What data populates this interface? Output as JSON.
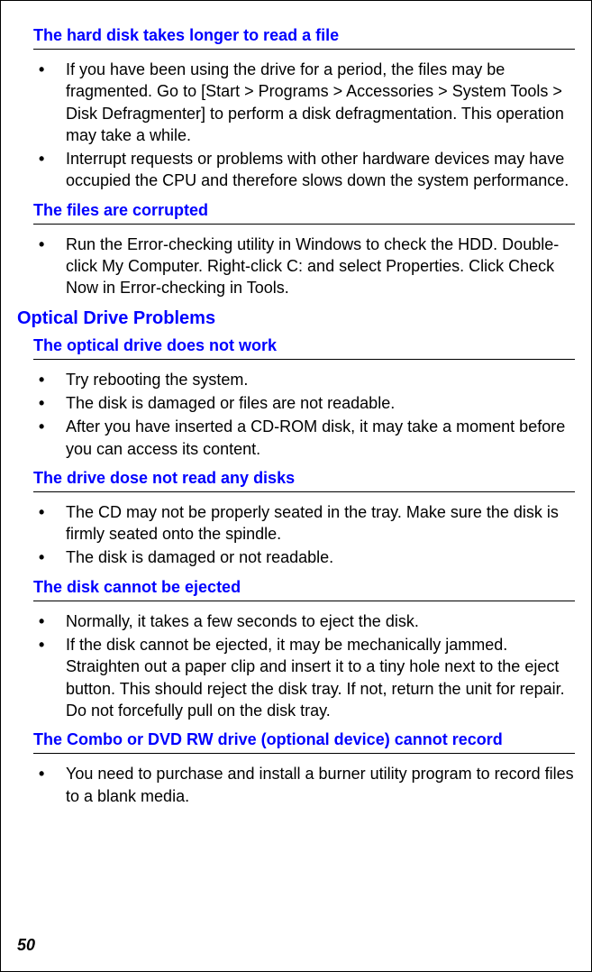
{
  "section1": {
    "heading1": "The hard disk takes longer to read a file",
    "bullets1": [
      "If you have been using the drive for a period, the files may be fragmented. Go to [Start > Programs > Accessories > System Tools > Disk Defragmenter] to perform a disk defragmentation. This operation may take a while.",
      "Interrupt requests or problems with other hardware devices may have occupied the CPU and therefore slows down the system performance."
    ],
    "heading2": "The files are corrupted",
    "bullets2": [
      "Run the Error-checking utility in Windows to check the HDD. Double-click My Computer. Right-click C: and select Properties. Click Check Now in Error-checking in Tools."
    ]
  },
  "section2": {
    "title": "Optical Drive Problems",
    "heading1": "The optical drive does not work",
    "bullets1": [
      "Try rebooting the system.",
      "The disk is damaged or files are not readable.",
      "After you have inserted a CD-ROM disk, it may take a moment before you can access its content."
    ],
    "heading2": "The drive dose not read any disks",
    "bullets2": [
      "The CD may not be properly seated in the tray. Make sure the disk is firmly seated onto the spindle.",
      "The disk is damaged or not readable."
    ],
    "heading3": "The disk cannot be ejected",
    "bullets3": [
      "Normally, it takes a few seconds to eject the disk.",
      "If the disk cannot be ejected, it may be mechanically jammed. Straighten out a paper clip and insert it to a tiny hole next to the eject button. This should reject the disk tray. If not, return the unit for repair. Do not forcefully pull on the disk tray."
    ],
    "heading4": "The Combo or DVD RW drive (optional device) cannot record",
    "bullets4": [
      "You need to purchase and install a burner utility program to record files to a blank media."
    ]
  },
  "pageNumber": "50"
}
